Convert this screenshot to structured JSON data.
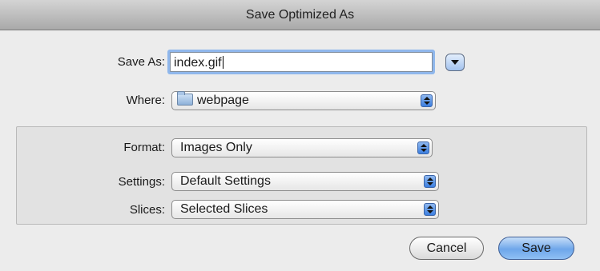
{
  "window": {
    "title": "Save Optimized As"
  },
  "save_as": {
    "label": "Save As:",
    "value": "index.gif"
  },
  "where": {
    "label": "Where:",
    "value": "webpage"
  },
  "format": {
    "label": "Format:",
    "value": "Images Only"
  },
  "settings": {
    "label": "Settings:",
    "value": "Default Settings"
  },
  "slices": {
    "label": "Slices:",
    "value": "Selected Slices"
  },
  "buttons": {
    "cancel": "Cancel",
    "save": "Save"
  },
  "colors": {
    "focus_ring": "#8fb7ec",
    "default_button": "#6ea6ea",
    "popup_arrows": "#3c7fe0"
  }
}
